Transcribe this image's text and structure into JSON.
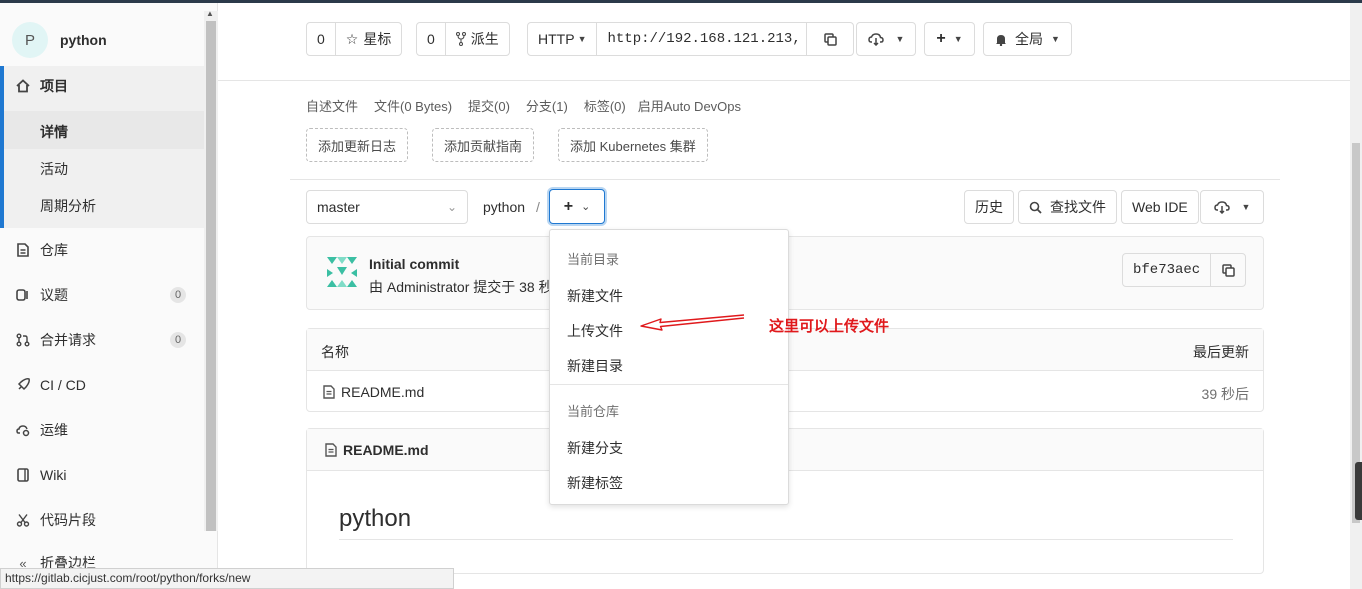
{
  "window": {
    "status_url": "https://gitlab.cicjust.com/root/python/forks/new"
  },
  "sidebar": {
    "avatar_letter": "P",
    "project_name": "python",
    "project_label": "项目",
    "sub_items": [
      "详情",
      "活动",
      "周期分析"
    ],
    "items": [
      {
        "label": "仓库",
        "icon": "doc-icon"
      },
      {
        "label": "议题",
        "icon": "issues-icon",
        "count": "0"
      },
      {
        "label": "合并请求",
        "icon": "merge-request-icon",
        "count": "0"
      },
      {
        "label": "CI / CD",
        "icon": "rocket-icon"
      },
      {
        "label": "运维",
        "icon": "cloud-gear-icon"
      },
      {
        "label": "Wiki",
        "icon": "book-icon"
      },
      {
        "label": "代码片段",
        "icon": "scissors-icon"
      }
    ],
    "collapse_label": "折叠边栏"
  },
  "header": {
    "star_count": "0",
    "star_label": "星标",
    "fork_count": "0",
    "fork_label": "派生",
    "protocol": "HTTP",
    "clone_url": "http://192.168.121.213,",
    "notify_label": "全局"
  },
  "stats": [
    "自述文件",
    "文件(0 Bytes)",
    "提交(0)",
    "分支(1)",
    "标签(0)",
    "启用Auto DevOps"
  ],
  "quick_actions": [
    "添加更新日志",
    "添加贡献指南",
    "添加 Kubernetes 集群"
  ],
  "tree": {
    "branch": "master",
    "path": "python",
    "history": "历史",
    "find_file": "查找文件",
    "web_ide": "Web IDE"
  },
  "commit": {
    "title": "Initial commit",
    "meta": "由 Administrator 提交于 38 秒",
    "sha": "bfe73aec"
  },
  "table": {
    "col_name": "名称",
    "col_updated": "最后更新",
    "rows": [
      {
        "name": "README.md",
        "updated": "39 秒后"
      }
    ]
  },
  "readme": {
    "file": "README.md",
    "heading": "python"
  },
  "dropdown": {
    "section1": "当前目录",
    "items1": [
      "新建文件",
      "上传文件",
      "新建目录"
    ],
    "section2": "当前仓库",
    "items2": [
      "新建分支",
      "新建标签"
    ]
  },
  "annotation": "这里可以上传文件",
  "colors": {
    "accent": "#1f78d1",
    "annotation": "#e0191c"
  }
}
